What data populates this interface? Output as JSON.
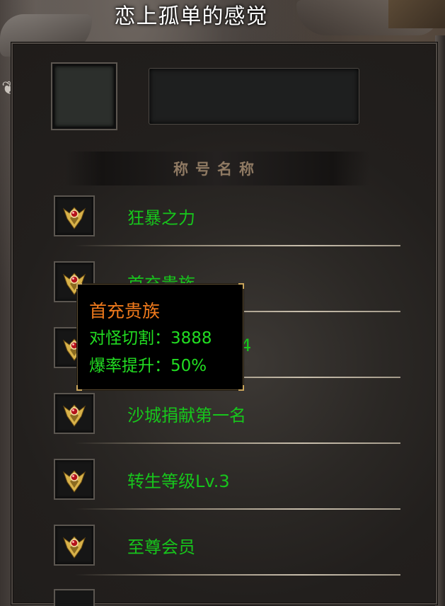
{
  "window": {
    "title": "恋上孤单的感觉"
  },
  "titles_header": "称号名称",
  "rows": [
    {
      "label": "狂暴之力",
      "icon": "winged-gem-emblem-icon"
    },
    {
      "label": "首充贵族",
      "icon": "winged-gem-emblem-icon"
    },
    {
      "label": "4",
      "icon": "winged-gem-emblem-icon"
    },
    {
      "label": "沙城捐献第一名",
      "icon": "winged-gem-emblem-icon"
    },
    {
      "label": "转生等级Lv.3",
      "icon": "winged-gem-emblem-icon"
    },
    {
      "label": "至尊会员",
      "icon": "winged-gem-emblem-icon"
    }
  ],
  "tooltip": {
    "title": "首充贵族",
    "line1": "对怪切割：3888",
    "line2": "爆率提升：50%"
  },
  "colors": {
    "row_label": "#17c51c",
    "tooltip_title": "#f07a1c",
    "tooltip_stats": "#22dd22",
    "header_text": "#8f7a63"
  }
}
